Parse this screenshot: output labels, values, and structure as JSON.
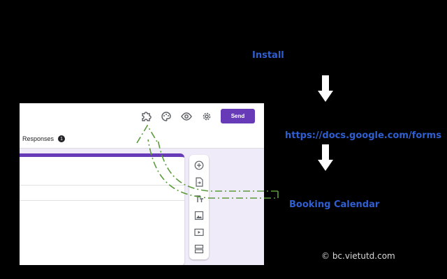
{
  "annotations": {
    "step1": "Install",
    "step2": "https://docs.google.com/forms",
    "step3": "Booking Calendar"
  },
  "watermark": "© bc.vietutd.com",
  "forms_ui": {
    "toolbar": {
      "icons": [
        "puzzle-icon",
        "palette-icon",
        "eye-icon",
        "gear-icon"
      ],
      "send_label": "Send"
    },
    "tabs": {
      "responses_label": "Responses",
      "responses_count": "1"
    },
    "side_tools": [
      "add-question-icon",
      "import-questions-icon",
      "add-title-icon",
      "add-image-icon",
      "add-video-icon",
      "add-section-icon"
    ]
  },
  "colors": {
    "accent": "#673ab7",
    "annotation": "#2f5fd0",
    "arrow": "#5a9a3c",
    "background": "#000000",
    "form_bg": "#f0ebf8"
  }
}
